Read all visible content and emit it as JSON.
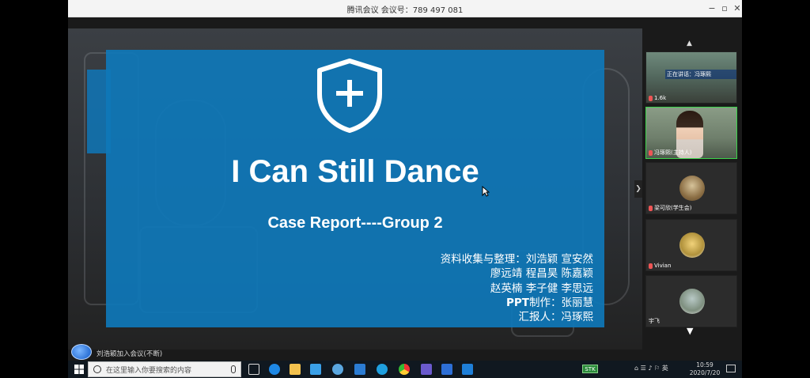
{
  "window": {
    "title": "腾讯会议 会议号：789 497 081",
    "minimize_glyph": "−",
    "maximize_glyph": "▫",
    "close_glyph": "✕"
  },
  "slide": {
    "panel_color": "#0f77b8",
    "icon": "shield-plus-icon",
    "title": "I Can Still Dance",
    "subtitle": "Case Report----Group 2",
    "credits": [
      "资料收集与整理：刘浩颖 宣安然",
      "廖远靖 程昌昊 陈嘉颖",
      "赵英楠 李子健 李思远"
    ],
    "ppt_label": "PPT",
    "ppt_rest": "制作：张丽慧",
    "reporter": "汇报人：冯琢熙"
  },
  "participants": [
    {
      "name": "正在讲话：冯琢熙",
      "label": "1.6k"
    },
    {
      "name": "冯琢熙(主持人)"
    },
    {
      "name": "梁可欣(学生会)"
    },
    {
      "name": "Vivian"
    },
    {
      "name": "宇飞"
    }
  ],
  "taskbar": {
    "search_placeholder": "在这里输入你要搜索的内容",
    "tray_badge": "STK",
    "tray_text": "⌂ ☰ ♪ ⚐ 英",
    "clock_time": "10:59",
    "clock_date": "2020/7/20"
  },
  "chat": {
    "text": "刘浩颖加入会议(不断)"
  },
  "colors": {
    "accent": "#0f77b8",
    "active_border": "#3bd24a",
    "taskbar": "#101820"
  }
}
